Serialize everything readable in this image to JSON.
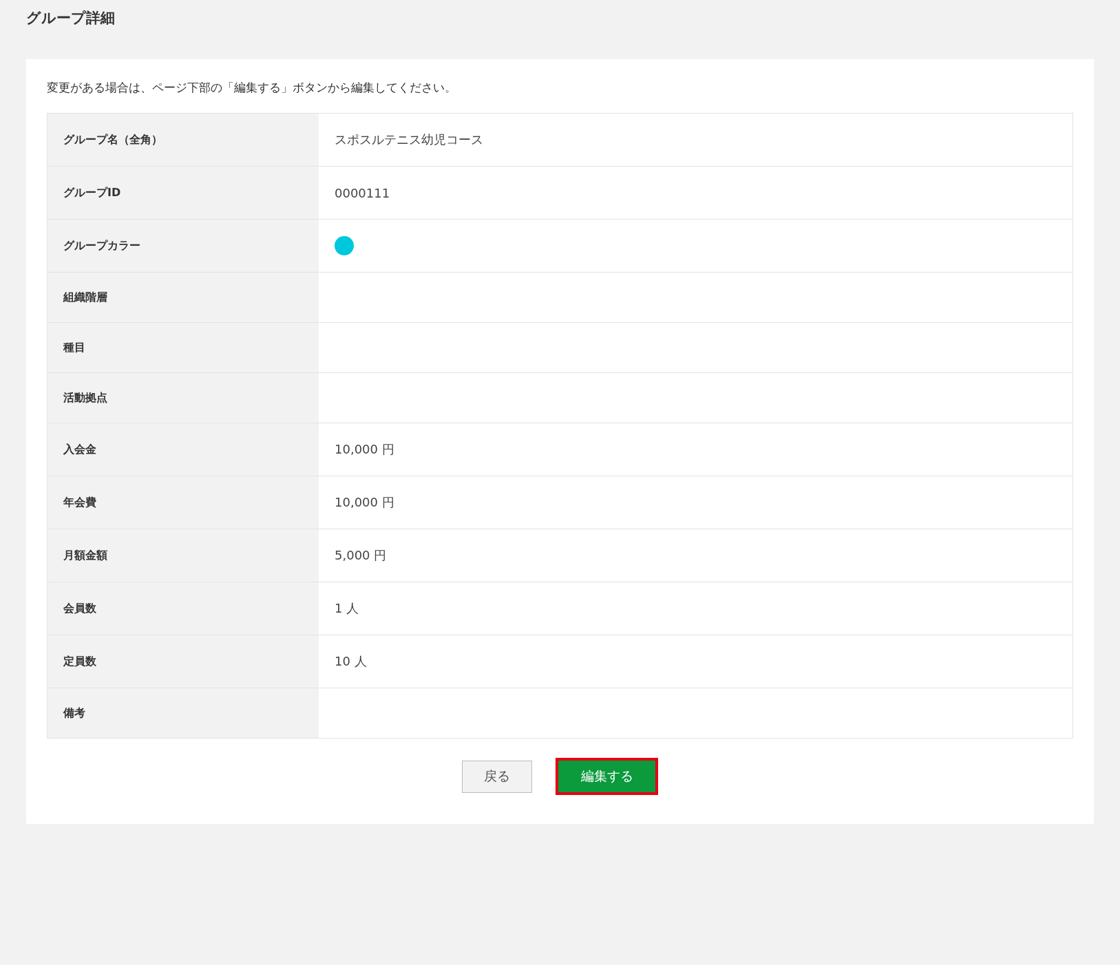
{
  "page": {
    "title": "グループ詳細"
  },
  "notice": "変更がある場合は、ページ下部の「編集する」ボタンから編集してください。",
  "rows": [
    {
      "label": "グループ名（全角）",
      "kind": "text",
      "value": "スポスルテニス幼児コース"
    },
    {
      "label": "グループID",
      "kind": "text",
      "value": "0000111"
    },
    {
      "label": "グループカラー",
      "kind": "color",
      "color": "#00c8dc"
    },
    {
      "label": "組織階層",
      "kind": "empty"
    },
    {
      "label": "種目",
      "kind": "empty"
    },
    {
      "label": "活動拠点",
      "kind": "empty"
    },
    {
      "label": "入会金",
      "kind": "text",
      "value": "10,000 円"
    },
    {
      "label": "年会費",
      "kind": "text",
      "value": "10,000 円"
    },
    {
      "label": "月額金額",
      "kind": "text",
      "value": "5,000 円"
    },
    {
      "label": "会員数",
      "kind": "text",
      "value": "1 人"
    },
    {
      "label": "定員数",
      "kind": "text",
      "value": "10 人"
    },
    {
      "label": "備考",
      "kind": "empty"
    }
  ],
  "buttons": [
    {
      "label": "戻る",
      "kind": "secondary",
      "highlighted": false
    },
    {
      "label": "編集する",
      "kind": "primary",
      "highlighted": true
    }
  ]
}
